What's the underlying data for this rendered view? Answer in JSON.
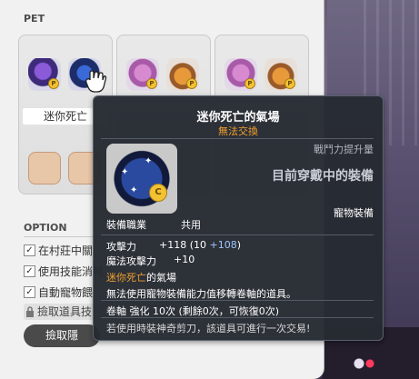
{
  "pet_window": {
    "title": "PET",
    "slots": [
      {
        "name": "迷你死亡",
        "icons": [
          "purple-pet-icon",
          "blue-pet-icon"
        ]
      },
      {
        "name": "",
        "icons": [
          "pink-pet-icon",
          "orange-pet-icon"
        ]
      },
      {
        "name": "",
        "icons": [
          "pink-pet-icon",
          "orange-pet-icon"
        ]
      }
    ],
    "coin_mark": "P"
  },
  "options": {
    "title": "OPTION",
    "checkboxes": [
      {
        "label": "在村莊中關",
        "checked": true
      },
      {
        "label": "使用技能消耗",
        "checked": true
      },
      {
        "label": "自動寵物餵",
        "checked": true
      }
    ],
    "pickup_label": "撿取道具技",
    "button_label": "撿取隱"
  },
  "tooltip": {
    "title": "迷你死亡的氣場",
    "trade": "無法交換",
    "compare_label": "戰鬥力提升量",
    "current_label": "目前穿戴中的裝備",
    "category": "寵物裝備",
    "job_label": "裝備職業",
    "job_value": "共用",
    "stats": [
      {
        "label": "攻擊力",
        "value": "+118 (10 ",
        "bonus": "+108",
        "close": ")"
      },
      {
        "label": "魔法攻擊力",
        "value": "+10",
        "bonus": "",
        "close": ""
      }
    ],
    "desc_name": "迷你死亡",
    "desc_name_tail": "的氣場",
    "desc1": "無法使用寵物裝備能力值移轉卷軸的道具。",
    "desc2": "卷軸 強化 10次 (剩餘0次，可恢復0次)",
    "desc3": "若使用時裝神奇剪刀，該道具可進行一次交易!",
    "coin_mark": "C"
  },
  "colors": {
    "trade_orange": "#f0a030",
    "bonus_blue": "#9ec7ff",
    "tooltip_bg": "#262a32"
  }
}
